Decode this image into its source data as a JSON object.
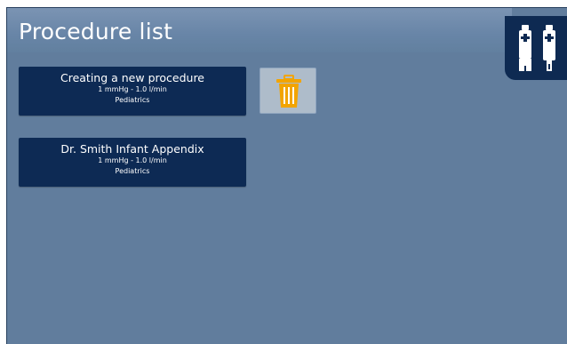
{
  "header": {
    "title": "Procedure list",
    "sensor_icons": [
      "probe-sensor-icon",
      "probe-sensor-icon"
    ]
  },
  "procedures": [
    {
      "name": "Creating a new procedure",
      "settings": "1 mmHg - 1.0 l/min",
      "category": "Pediatrics",
      "selected": true
    },
    {
      "name": "Dr. Smith Infant Appendix",
      "settings": "1 mmHg - 1.0 l/min",
      "category": "Pediatrics",
      "selected": false
    }
  ],
  "actions": {
    "delete_icon": "trash-icon"
  },
  "colors": {
    "background": "#617d9d",
    "card": "#0d2a54",
    "trash_icon": "#f2a400",
    "trash_button": "#aebcca"
  }
}
